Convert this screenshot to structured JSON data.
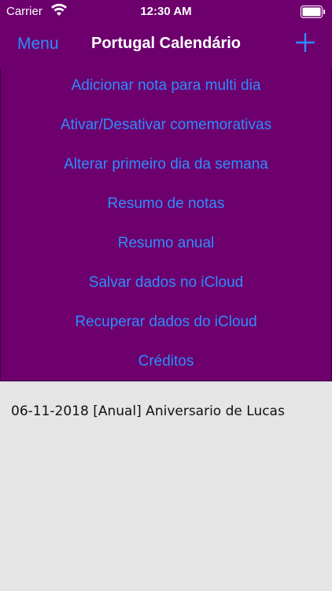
{
  "status_bar": {
    "carrier": "Carrier",
    "time": "12:30 AM"
  },
  "nav": {
    "menu_label": "Menu",
    "title": "Portugal Calendário",
    "add_icon": "plus-icon"
  },
  "menu": {
    "items": [
      "Adicionar nota para multi dia",
      "Ativar/Desativar comemorativas",
      "Alterar primeiro dia da semana",
      "Resumo de notas",
      "Resumo anual",
      "Salvar dados no iCloud",
      "Recuperar dados do iCloud",
      "Créditos"
    ]
  },
  "notes": {
    "items": [
      "06-11-2018 [Anual] Aniversario de Lucas"
    ]
  },
  "colors": {
    "background_purple": "#6d006d",
    "link_blue": "#2f8bff",
    "notes_background": "#e5e5e5"
  }
}
